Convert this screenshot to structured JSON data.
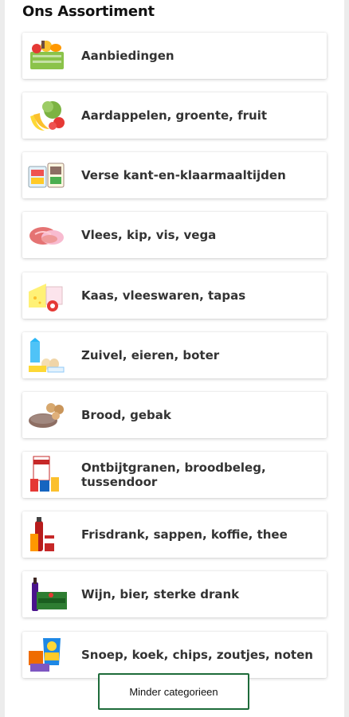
{
  "heading": "Ons Assortiment",
  "categories": [
    {
      "label": "Aanbiedingen",
      "icon": "groceries-crate-icon"
    },
    {
      "label": "Aardappelen, groente, fruit",
      "icon": "fruit-vegetables-icon"
    },
    {
      "label": "Verse kant-en-klaarmaaltijden",
      "icon": "ready-meal-icon"
    },
    {
      "label": "Vlees, kip, vis, vega",
      "icon": "meat-icon"
    },
    {
      "label": "Kaas, vleeswaren, tapas",
      "icon": "cheese-icon"
    },
    {
      "label": "Zuivel, eieren, boter",
      "icon": "dairy-eggs-icon"
    },
    {
      "label": "Brood, gebak",
      "icon": "bread-icon"
    },
    {
      "label": "Ontbijtgranen, broodbeleg, tussendoor",
      "icon": "cereal-icon"
    },
    {
      "label": "Frisdrank, sappen, koffie, thee",
      "icon": "soft-drinks-icon"
    },
    {
      "label": "Wijn, bier, sterke drank",
      "icon": "wine-beer-icon"
    },
    {
      "label": "Snoep, koek, chips, zoutjes, noten",
      "icon": "snacks-icon"
    }
  ],
  "less_button_label": "Minder categorieen",
  "colors": {
    "button_border": "#1e6b3a",
    "label_text": "#333333"
  }
}
